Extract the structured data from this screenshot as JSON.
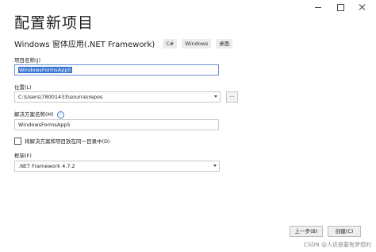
{
  "window": {
    "title": "配置新项目"
  },
  "template": {
    "name": "Windows 窗体应用(.NET Framework)",
    "tags": [
      "C#",
      "Windows",
      "桌面"
    ]
  },
  "project_name": {
    "label": "项目名称(J)",
    "value": "WindowsFormsApp5"
  },
  "location": {
    "label": "位置(L)",
    "value": "C:\\Users\\78001433\\source\\repos",
    "browse_label": "..."
  },
  "solution_name": {
    "label": "解决方案名称(M)",
    "info_icon": "info-icon",
    "value": "WindowsFormsApp5"
  },
  "same_dir": {
    "label": "将解决方案和项目放在同一目录中(D)",
    "checked": false
  },
  "framework": {
    "label": "框架(F)",
    "value": ".NET Framework 4.7.2"
  },
  "footer": {
    "back_label": "上一步(B)",
    "create_label": "创建(C)"
  },
  "watermark": "CSDN @人还是要有梦想的"
}
